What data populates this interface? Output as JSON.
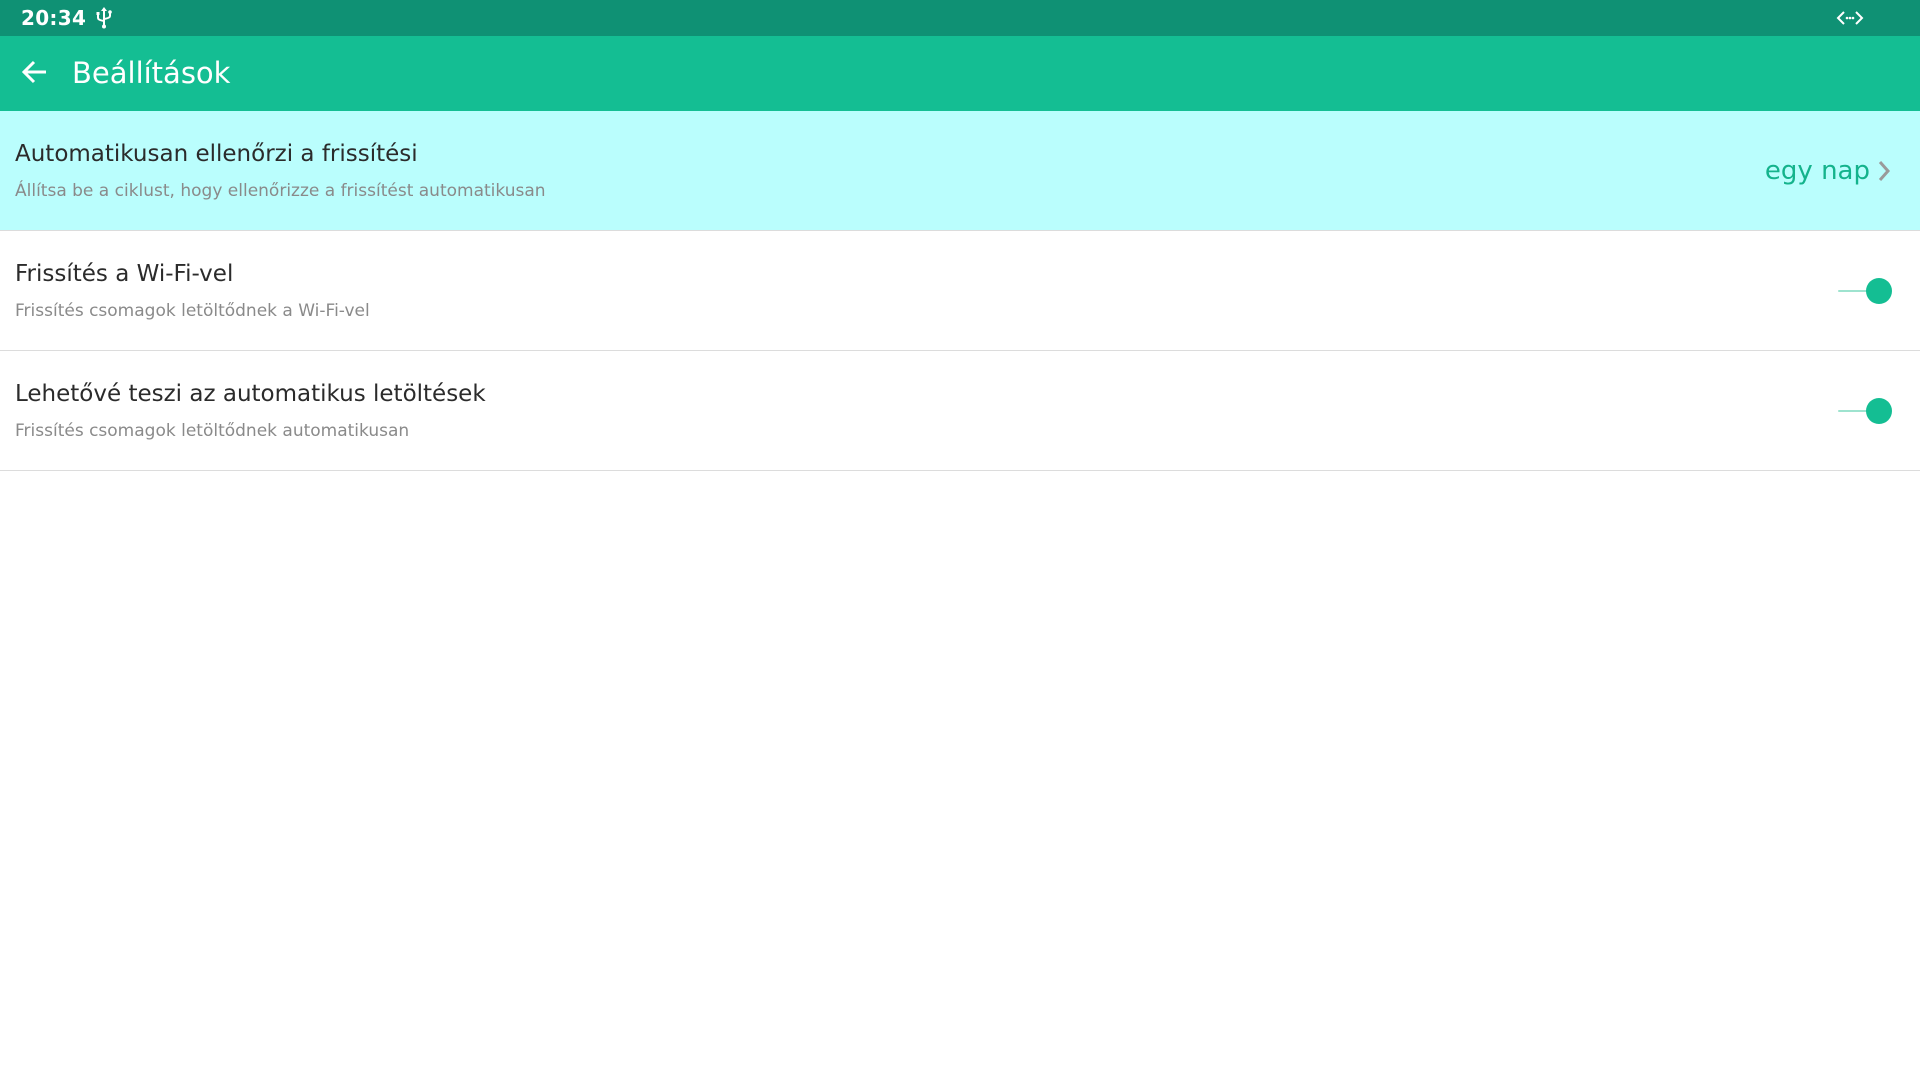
{
  "status_bar": {
    "time": "20:34",
    "left_icon": "usb-icon",
    "right_icon": "developer-mode-icon"
  },
  "app_bar": {
    "back_icon": "arrow-left-icon",
    "title": "Beállítások"
  },
  "settings": [
    {
      "title": "Automatikusan ellenőrzi a frissítési",
      "subtitle": "Állítsa be a ciklust, hogy ellenőrizze a frissítést automatikusan",
      "value": "egy nap",
      "control": "chevron-right-icon",
      "selected": true
    },
    {
      "title": "Frissítés a Wi-Fi-vel",
      "subtitle": "Frissítés csomagok letöltődnek a Wi-Fi-vel",
      "control": "toggle",
      "enabled": true
    },
    {
      "title": "Lehetővé teszi az automatikus letöltések",
      "subtitle": "Frissítés csomagok letöltődnek automatikusan",
      "control": "toggle",
      "enabled": true
    }
  ],
  "colors": {
    "status_bar": "#0f9174",
    "app_bar": "#14be93",
    "selected_row": "#bafefd",
    "accent": "#14b38c",
    "divider": "#dcdcdc"
  }
}
